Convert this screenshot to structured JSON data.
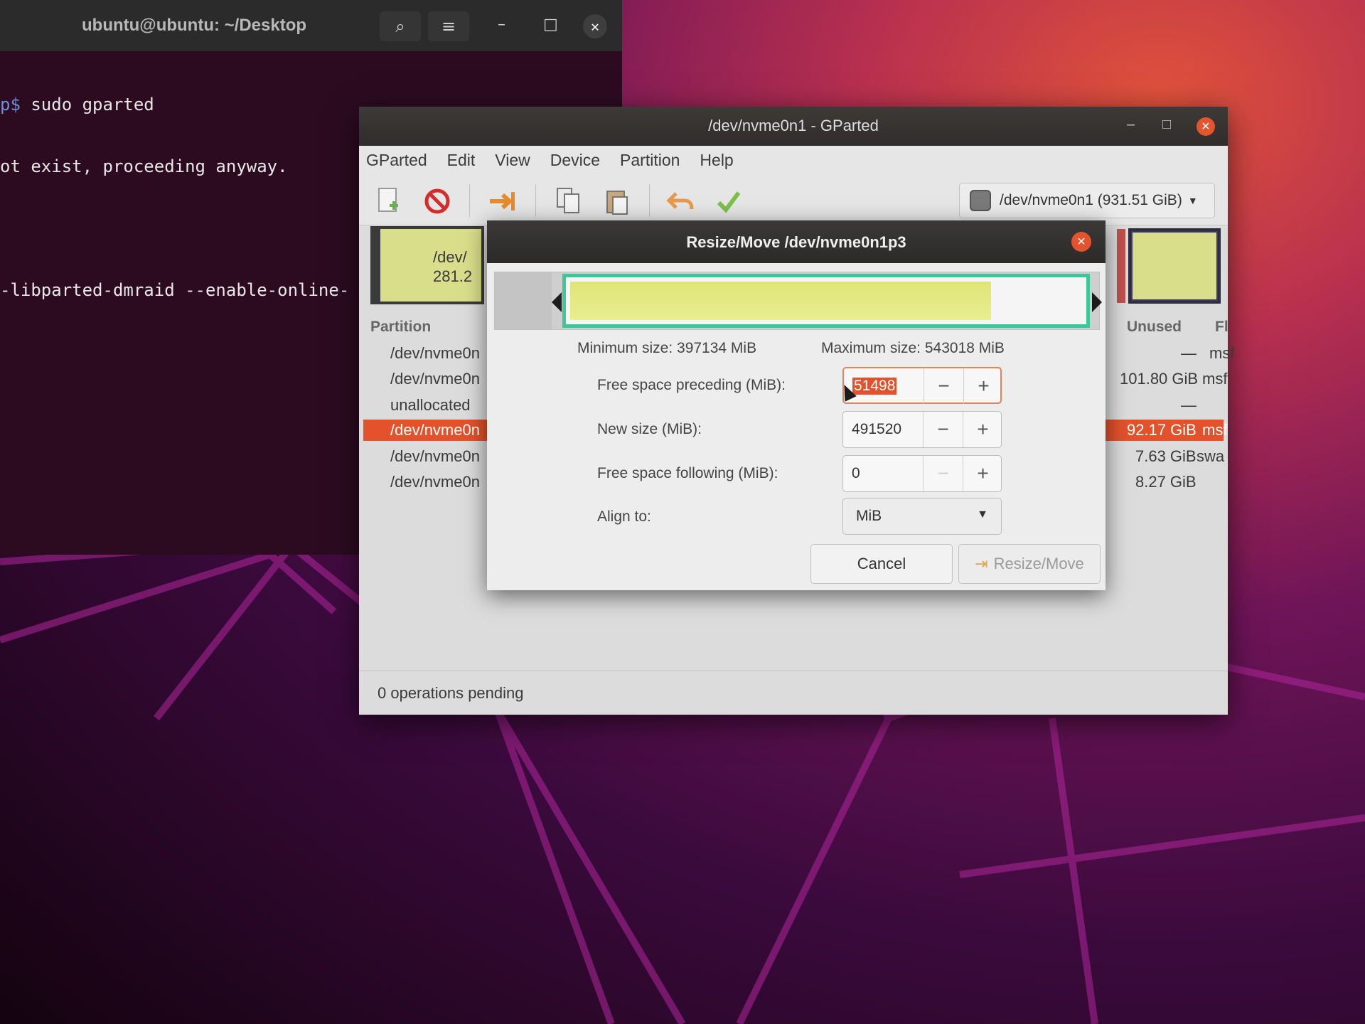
{
  "terminal": {
    "title": "ubuntu@ubuntu: ~/Desktop",
    "lines": [
      {
        "prefix": "p$",
        "text": " sudo gparted"
      },
      {
        "prefix": "",
        "text": "ot exist, proceeding anyway."
      },
      {
        "prefix": "",
        "text": ""
      },
      {
        "prefix": "",
        "text": "-libparted-dmraid --enable-online-"
      }
    ],
    "controls": {
      "minimize": "–",
      "maximize": "□",
      "close": "✕",
      "search": "⌕",
      "menu": "≡"
    }
  },
  "gparted": {
    "title": "/dev/nvme0n1 - GParted",
    "menu": [
      "GParted",
      "Edit",
      "View",
      "Device",
      "Partition",
      "Help"
    ],
    "toolbar_icons": [
      "new-icon",
      "delete-icon",
      "resize-move-icon",
      "copy-icon",
      "paste-icon",
      "undo-icon",
      "apply-icon"
    ],
    "device": "/dev/nvme0n1 (931.51 GiB)",
    "graph_left": {
      "line1": "/dev/",
      "line2": "281.2"
    },
    "columns": {
      "partition": "Partition",
      "unused": "Unused",
      "flags": "Fl"
    },
    "rows": [
      {
        "name": "/dev/nvme0n",
        "unused": "—",
        "flags": "msf",
        "selected": false
      },
      {
        "name": "/dev/nvme0n",
        "unused": "101.80 GiB",
        "flags": "msf",
        "selected": false
      },
      {
        "name": "unallocated",
        "unused": "—",
        "flags": "",
        "selected": false
      },
      {
        "name": "/dev/nvme0n",
        "unused": "92.17 GiB",
        "flags": "msf",
        "selected": true
      },
      {
        "name": "/dev/nvme0n",
        "unused": "7.63 GiB",
        "flags": "swa",
        "selected": false
      },
      {
        "name": "/dev/nvme0n",
        "unused": "8.27 GiB",
        "flags": "",
        "selected": false
      }
    ],
    "status": "0 operations pending"
  },
  "dialog": {
    "title": "Resize/Move /dev/nvme0n1p3",
    "minimum": "Minimum size: 397134 MiB",
    "maximum": "Maximum size: 543018 MiB",
    "used_fraction": 0.82,
    "fields": {
      "preceding_label": "Free space preceding (MiB):",
      "preceding_value": "51498",
      "newsize_label": "New size (MiB):",
      "newsize_value": "491520",
      "following_label": "Free space following (MiB):",
      "following_value": "0",
      "align_label": "Align to:",
      "align_value": "MiB"
    },
    "buttons": {
      "cancel": "Cancel",
      "resize": "Resize/Move"
    },
    "spin_minus": "−",
    "spin_plus": "+"
  },
  "colors": {
    "accent": "#e3522b",
    "partition_fill": "#d8de8a",
    "frame": "#3ac89a"
  }
}
